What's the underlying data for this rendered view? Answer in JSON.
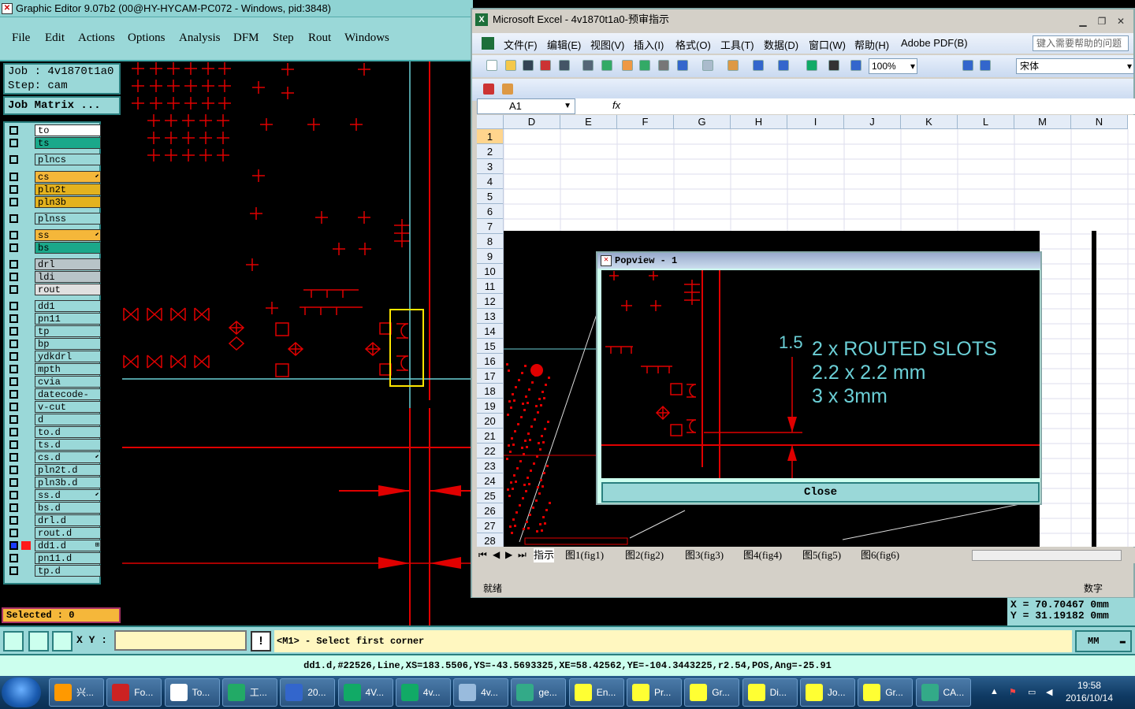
{
  "ge": {
    "title": "Graphic Editor 9.07b2 (00@HY-HYCAM-PC072 - Windows, pid:3848)",
    "menu": [
      "File",
      "Edit",
      "Actions",
      "Options",
      "Analysis",
      "DFM",
      "Step",
      "Rout",
      "Windows"
    ],
    "job": "Job : 4v1870t1a0",
    "step": "Step: cam",
    "job_matrix": "Job Matrix ...",
    "selected": "Selected : 0",
    "layers": [
      {
        "name": "to",
        "color": "#ffffff",
        "mark": ""
      },
      {
        "name": "ts",
        "color": "#1aa88a",
        "mark": ""
      },
      {
        "name": "plncs",
        "color": "#9ad8d8",
        "mark": ""
      },
      {
        "name": "cs",
        "color": "#f5b73a",
        "mark": "⬋"
      },
      {
        "name": "pln2t",
        "color": "#e3b21e",
        "mark": ""
      },
      {
        "name": "pln3b",
        "color": "#e3b21e",
        "mark": ""
      },
      {
        "name": "plnss",
        "color": "#9ad8d8",
        "mark": ""
      },
      {
        "name": "ss",
        "color": "#f5b73a",
        "mark": "⬋"
      },
      {
        "name": "bs",
        "color": "#1aa88a",
        "mark": ""
      },
      {
        "name": "drl",
        "color": "#b8c4c8",
        "mark": ""
      },
      {
        "name": "ldi",
        "color": "#b8c4c8",
        "mark": ""
      },
      {
        "name": "rout",
        "color": "#e0e0e0",
        "mark": ""
      },
      {
        "name": "dd1",
        "color": "#9ad8d8",
        "mark": ""
      },
      {
        "name": "pn11",
        "color": "#9ad8d8",
        "mark": ""
      },
      {
        "name": "tp",
        "color": "#9ad8d8",
        "mark": ""
      },
      {
        "name": "bp",
        "color": "#9ad8d8",
        "mark": ""
      },
      {
        "name": "ydkdrl",
        "color": "#9ad8d8",
        "mark": ""
      },
      {
        "name": "mpth",
        "color": "#9ad8d8",
        "mark": ""
      },
      {
        "name": "cvia",
        "color": "#9ad8d8",
        "mark": ""
      },
      {
        "name": "datecode-ts",
        "color": "#9ad8d8",
        "mark": ""
      },
      {
        "name": "v-cut",
        "color": "#9ad8d8",
        "mark": ""
      },
      {
        "name": "d",
        "color": "#9ad8d8",
        "mark": ""
      },
      {
        "name": "to.d",
        "color": "#9ad8d8",
        "mark": ""
      },
      {
        "name": "ts.d",
        "color": "#9ad8d8",
        "mark": ""
      },
      {
        "name": "cs.d",
        "color": "#9ad8d8",
        "mark": "⬋"
      },
      {
        "name": "pln2t.d",
        "color": "#9ad8d8",
        "mark": ""
      },
      {
        "name": "pln3b.d",
        "color": "#9ad8d8",
        "mark": ""
      },
      {
        "name": "ss.d",
        "color": "#9ad8d8",
        "mark": "⬋"
      },
      {
        "name": "bs.d",
        "color": "#9ad8d8",
        "mark": ""
      },
      {
        "name": "drl.d",
        "color": "#9ad8d8",
        "mark": ""
      },
      {
        "name": "rout.d",
        "color": "#9ad8d8",
        "mark": ""
      },
      {
        "name": "dd1.d",
        "color": "#9ad8d8",
        "mark": "⊞",
        "active": true
      },
      {
        "name": "pn11.d",
        "color": "#9ad8d8",
        "mark": ""
      },
      {
        "name": "tp.d",
        "color": "#9ad8d8",
        "mark": ""
      }
    ],
    "xy_label": "X Y :",
    "prompt": "<M1> - Select first corner",
    "units": "MM",
    "info": "dd1.d,#22526,Line,XS=183.5506,YS=-43.5693325,XE=58.42562,YE=-104.3443225,r2.54,POS,Ang=-25.91",
    "coord_x": "X = 70.70467 0mm",
    "coord_y": "Y = 31.19182 0mm"
  },
  "excel": {
    "title": "Microsoft Excel - 4v1870t1a0-预审指示",
    "menu": [
      "文件(F)",
      "编辑(E)",
      "视图(V)",
      "插入(I)",
      "格式(O)",
      "工具(T)",
      "数据(D)",
      "窗口(W)",
      "帮助(H)",
      "Adobe PDF(B)"
    ],
    "help_placeholder": "键入需要帮助的问题",
    "zoom": "100%",
    "font": "宋体",
    "namebox": "A1",
    "fx": "fx",
    "columns": [
      "D",
      "E",
      "F",
      "G",
      "H",
      "I",
      "J",
      "K",
      "L",
      "M",
      "N"
    ],
    "rows": [
      "1",
      "2",
      "3",
      "4",
      "5",
      "6",
      "7",
      "8",
      "9",
      "10",
      "11",
      "12",
      "13",
      "14",
      "15",
      "16",
      "17",
      "18",
      "19",
      "20",
      "21",
      "22",
      "23",
      "24",
      "25",
      "26",
      "27",
      "28"
    ],
    "sheets": [
      "指示",
      "图1(fig1)",
      "图2(fig2)",
      "图3(fig3)",
      "图4(fig4)",
      "图5(fig5)",
      "图6(fig6)"
    ],
    "status_left": "就绪",
    "status_right": "数字"
  },
  "popview": {
    "title": "Popview - 1",
    "dim": "1.5",
    "line1": "2 x ROUTED SLOTS",
    "line2": "2.2 x 2.2 mm",
    "line3": "3 x 3mm",
    "close": "Close"
  },
  "taskbar": {
    "items": [
      "兴...",
      "Fo...",
      "To...",
      "工...",
      "20...",
      "4V...",
      "4v...",
      "4v...",
      "ge...",
      "En...",
      "Pr...",
      "Gr...",
      "Di...",
      "Jo...",
      "Gr...",
      "CA..."
    ],
    "time": "19:58",
    "date": "2016/10/14"
  },
  "colors": {
    "accent": "#9ad8d8",
    "cad_red": "#e00000",
    "cad_cyan": "#6bcfd6",
    "highlight_yellow": "#ffe600"
  }
}
